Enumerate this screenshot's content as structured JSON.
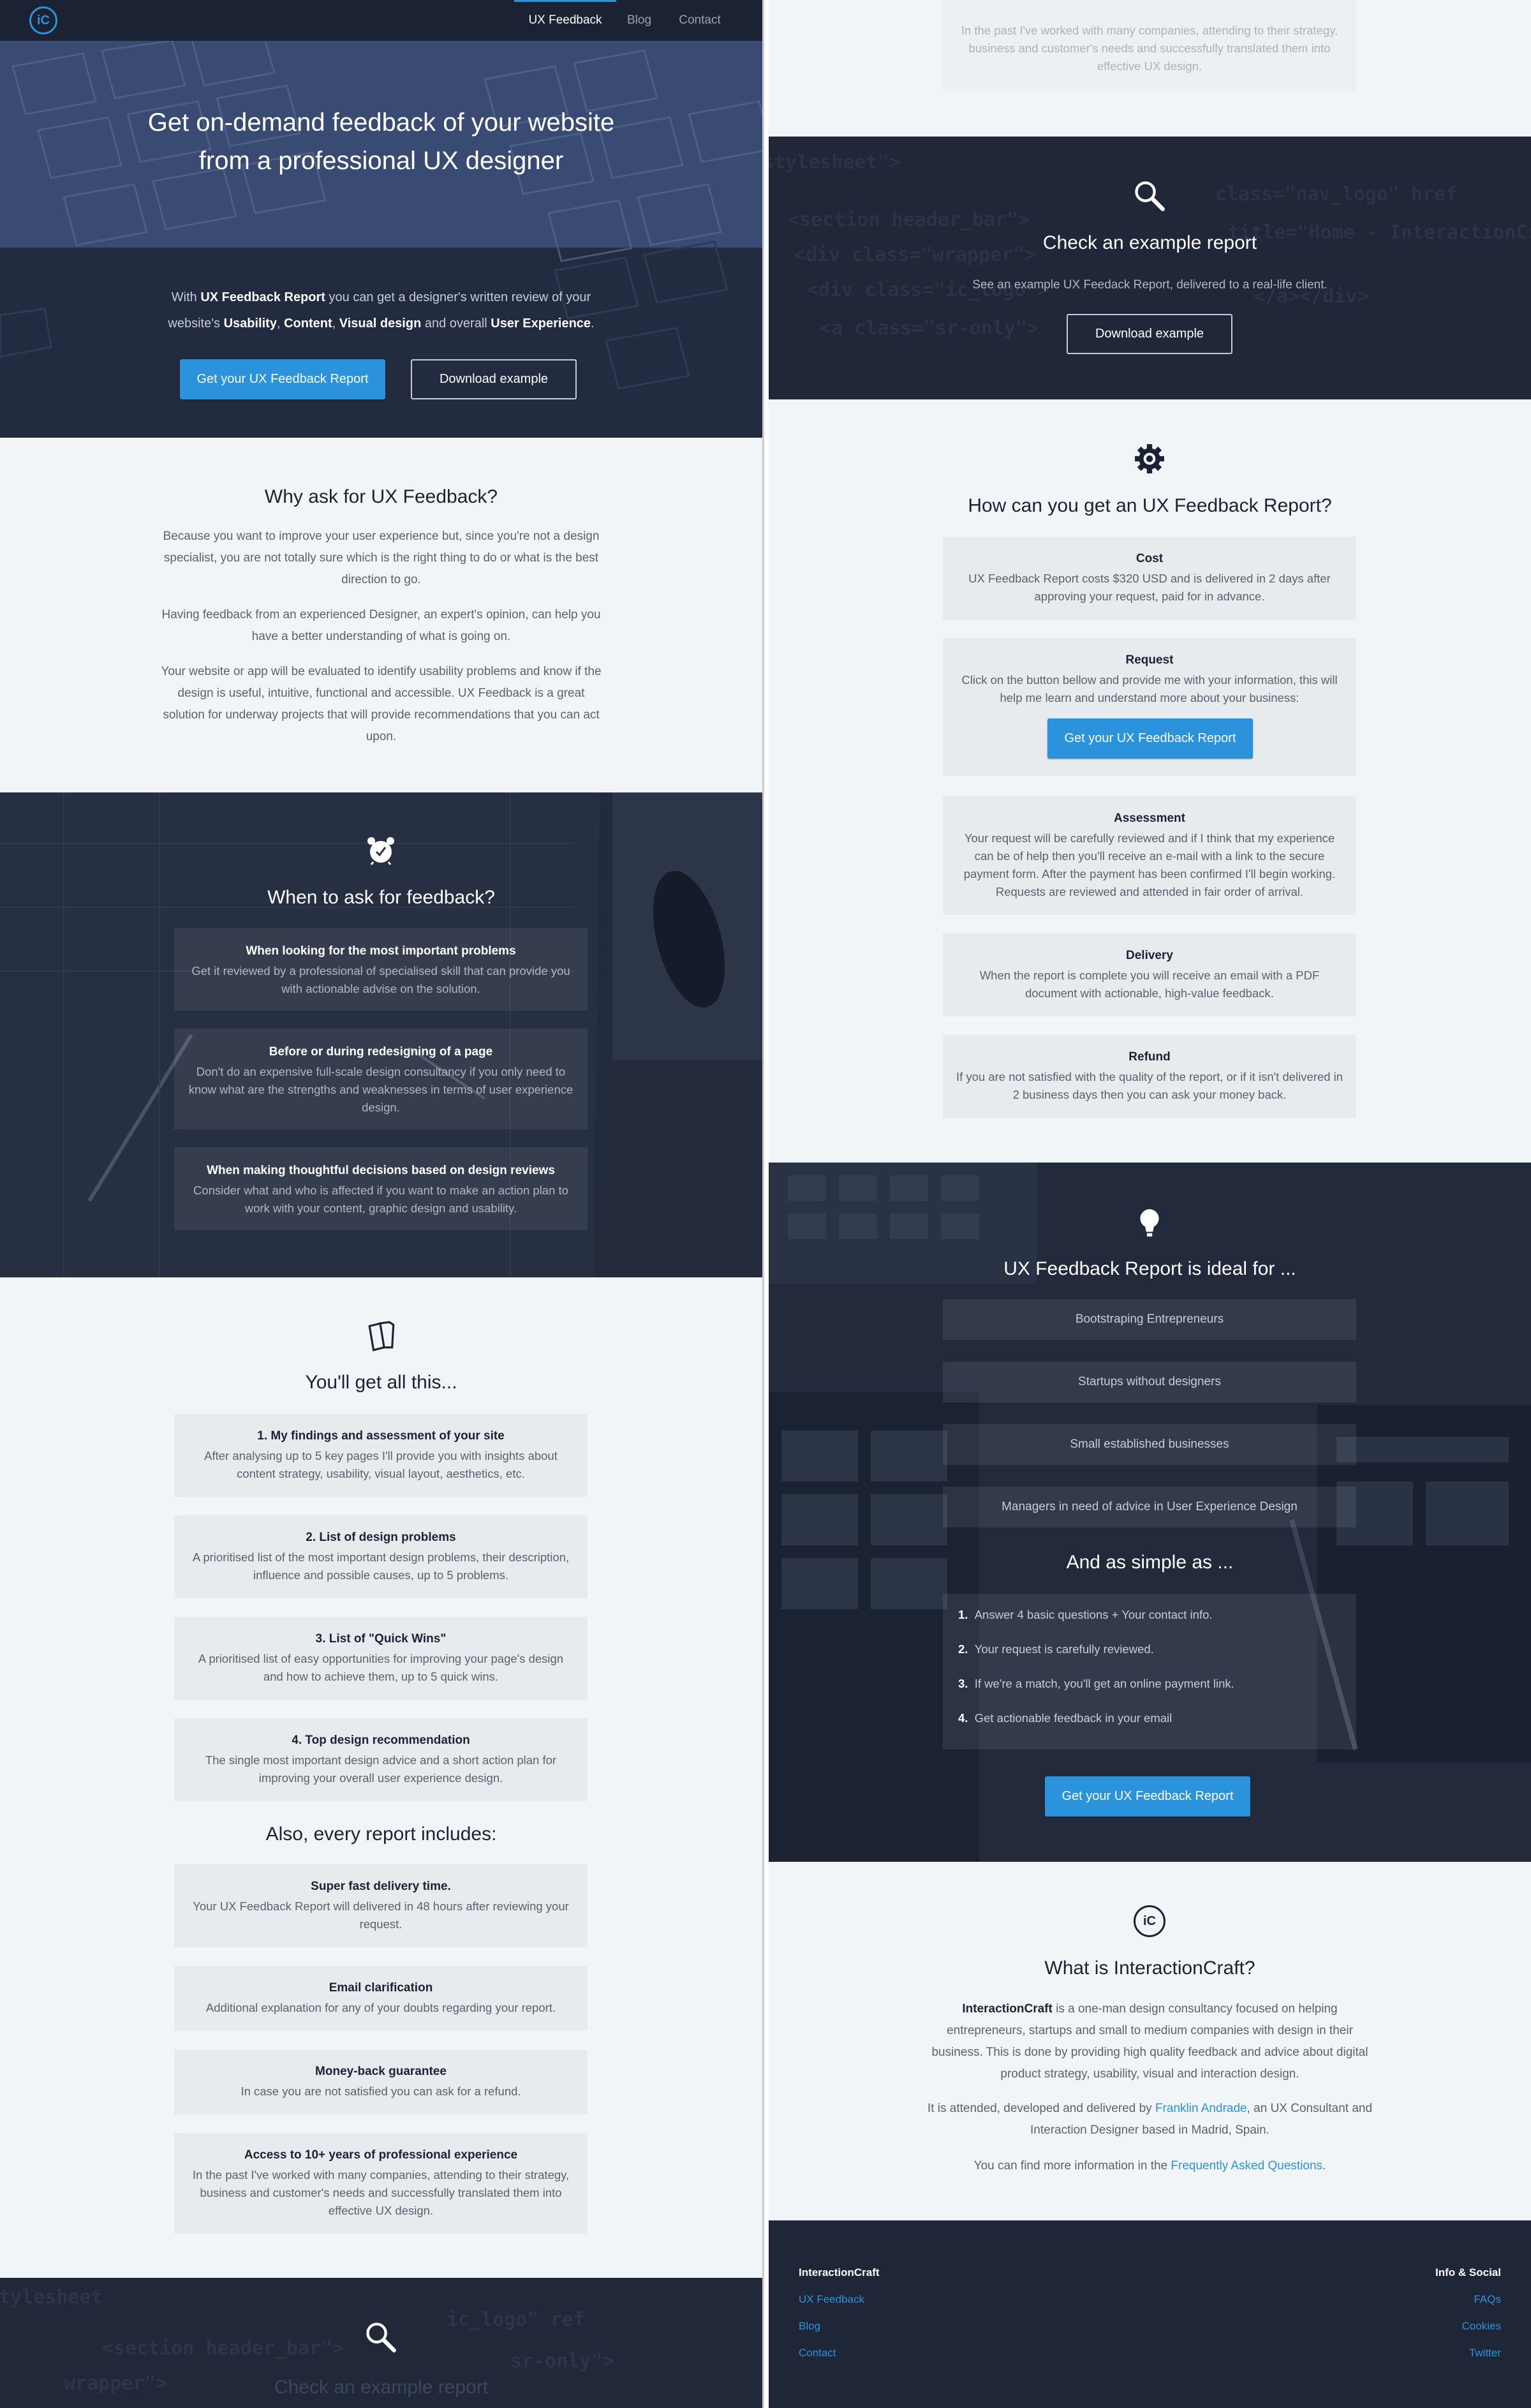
{
  "nav": {
    "logo_letters": "iC",
    "items": [
      "UX Feedback",
      "Blog",
      "Contact"
    ],
    "active": "UX Feedback"
  },
  "hero": {
    "title_line1": "Get on-demand feedback of your website",
    "title_line2": "from a professional UX designer",
    "intro_1": "With ",
    "intro_b1": "UX Feedback Report",
    "intro_2": " you can get a designer's written review of your",
    "intro_3": "website's ",
    "intro_b2": "Usability",
    "intro_sep1": ", ",
    "intro_b3": "Content",
    "intro_sep2": ", ",
    "intro_b4": "Visual design",
    "intro_4": " and overall ",
    "intro_b5": "User Experience",
    "intro_5": ".",
    "cta_primary": "Get your UX Feedback Report",
    "cta_secondary": "Download example"
  },
  "why": {
    "title": "Why ask for UX Feedback?",
    "p1": "Because you want to improve your user experience but, since you're not a design specialist, you are not totally sure which is the right thing to do or what is the best direction to go.",
    "p2": "Having feedback from an experienced Designer, an expert's opinion, can help you have a better understanding of what is going on.",
    "p3": "Your website or app will be evaluated to identify usability problems and know if the design is useful, intuitive, functional and accessible. UX Feedback is a great solution for underway projects that will provide recommendations that you can act upon."
  },
  "when": {
    "title": "When to ask for feedback?",
    "items": [
      {
        "title": "When looking for the most important problems",
        "desc": "Get it reviewed by a professional of specialised skill that can provide you with actionable advise on the solution."
      },
      {
        "title": "Before or during redesigning of a page",
        "desc": "Don't do an expensive full-scale design consultancy if you only need to know what are the strengths and weaknesses in terms of user experience design."
      },
      {
        "title": "When making thoughtful decisions based on design reviews",
        "desc": "Consider what and who is affected if you want to make an action plan to work with your content, graphic design and usability."
      }
    ]
  },
  "get": {
    "title": "You'll get all this...",
    "items": [
      {
        "title": "1. My findings and assessment of your site",
        "desc": "After analysing up to 5 key pages I'll provide you with insights about content strategy, usability, visual layout, aesthetics, etc."
      },
      {
        "title": "2. List of design problems",
        "desc": "A prioritised list of the most important design problems, their description, influence and possible causes, up to 5 problems."
      },
      {
        "title": "3. List of \"Quick Wins\"",
        "desc": "A prioritised list of easy opportunities for improving your page's design and how to achieve them, up to 5 quick wins."
      },
      {
        "title": "4. Top design recommendation",
        "desc": "The single most important design advice and a short action plan for improving your overall user experience design."
      }
    ]
  },
  "also": {
    "title": "Also, every report includes:",
    "items": [
      {
        "title": "Super fast delivery time.",
        "desc": "Your UX Feedback Report will delivered in 48 hours after reviewing your request."
      },
      {
        "title": "Email clarification",
        "desc": "Additional explanation for any of your doubts regarding your report."
      },
      {
        "title": "Money-back guarantee",
        "desc": "In case you are not satisfied you can ask for a refund."
      },
      {
        "title": "Access to 10+ years of professional experience",
        "desc": "In the past I've worked with many companies, attending to their strategy, business and customer's needs and successfully translated them into effective UX design."
      }
    ]
  },
  "example": {
    "title": "Check an example report",
    "desc": "See an example UX Feedack Report, delivered to a real-life client.",
    "button": "Download example"
  },
  "how": {
    "title": "How can you get an UX Feedback Report?",
    "items": [
      {
        "title": "Cost",
        "desc": "UX Feedback Report costs $320 USD and is delivered in 2 days after approving your request, paid for in advance."
      },
      {
        "title": "Request",
        "desc": "Click on the button bellow and provide me with your information, this will help me learn and understand more about your business:",
        "button": "Get your UX Feedback Report"
      },
      {
        "title": "Assessment",
        "desc": "Your request will be carefully reviewed and if I think that my experience can be of help then you'll receive an e-mail with a link to the secure payment form. After the payment has been confirmed I'll begin working. Requests are reviewed and attended in fair order of arrival."
      },
      {
        "title": "Delivery",
        "desc": "When the report is complete you will receive an email with a PDF document with actionable, high-value feedback."
      },
      {
        "title": "Refund",
        "desc": "If you are not satisfied with the quality of the report, or if it isn't delivered in 2 business days then you can ask your money back."
      }
    ]
  },
  "ideal": {
    "title": "UX Feedback Report is ideal for ...",
    "items": [
      "Bootstraping Entrepreneurs",
      "Startups without designers",
      "Small established businesses",
      "Managers in need of advice in User Experience Design"
    ],
    "simple_title": "And as simple as ...",
    "steps": [
      "Answer 4 basic questions + Your contact info.",
      "Your request is carefully reviewed.",
      "If we're a match, you'll get an online payment link.",
      "Get actionable feedback in your email"
    ],
    "step_numbers": [
      "1.",
      "2.",
      "3.",
      "4."
    ],
    "button": "Get your UX Feedback Report"
  },
  "about": {
    "title": "What is InteractionCraft?",
    "brand": "InteractionCraft",
    "p1_rest": " is a one-man design consultancy focused on helping entrepreneurs, startups and small to medium companies with design in their business. This is done by providing high quality feedback and advice about digital product strategy, usability, visual and interaction design.",
    "p2_a": "It is attended, developed and delivered by ",
    "p2_link": "Franklin Andrade",
    "p2_b": ", an UX Consultant and Interaction Designer based in Madrid, Spain.",
    "p3_a": "You can find more information in the ",
    "p3_link": "Frequently Asked Questions",
    "p3_b": "."
  },
  "footer": {
    "left_title": "InteractionCraft",
    "left_links": [
      "UX Feedback",
      "Blog",
      "Contact"
    ],
    "right_title": "Info & Social",
    "right_links": [
      "FAQs",
      "Cookies",
      "Twitter"
    ]
  },
  "colors": {
    "accent": "#2a93db",
    "dark": "#1e2638",
    "light": "#f2f5f7"
  }
}
